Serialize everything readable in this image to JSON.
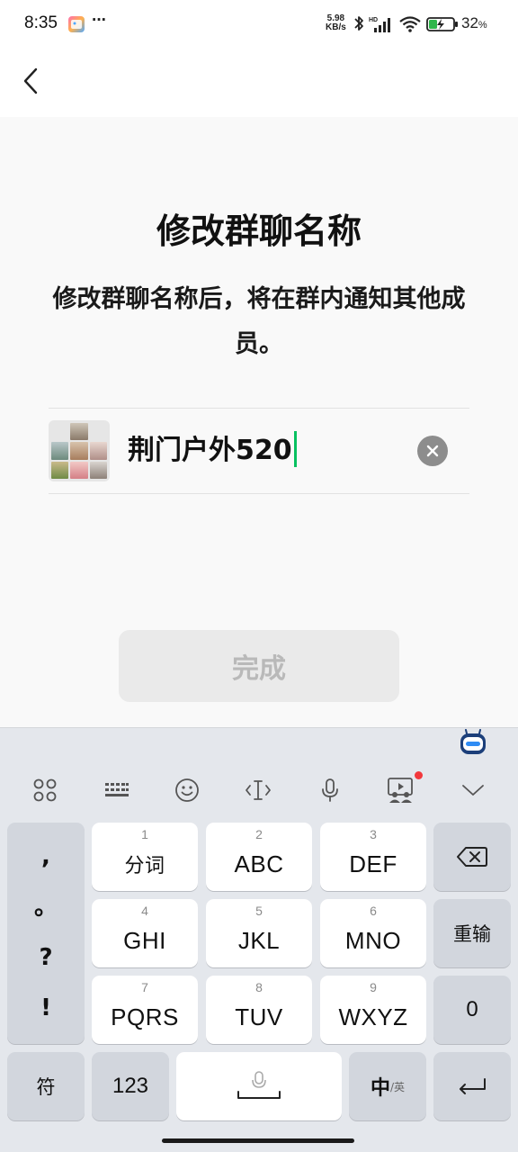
{
  "status_bar": {
    "time": "8:35",
    "dots": "···",
    "net_speed_value": "5.98",
    "net_speed_unit": "KB/s",
    "battery_percent": "32",
    "battery_unit": "%"
  },
  "header": {
    "back_icon": "chevron-left-icon"
  },
  "main": {
    "title": "修改群聊名称",
    "description": "修改群聊名称后，将在群内通知其他成员。",
    "group_name_value": "荆门户外520",
    "clear_icon": "close-circle-icon",
    "done_label": "完成"
  },
  "keyboard": {
    "toolbar_icons": [
      "grid-icon",
      "keyboard-icon",
      "emoji-icon",
      "cursor-icon",
      "microphone-icon",
      "screen-share-icon",
      "chevron-down-icon"
    ],
    "punct": [
      ",",
      "。",
      "?",
      "!"
    ],
    "keys": [
      {
        "num": "1",
        "label": "分词"
      },
      {
        "num": "2",
        "label": "ABC"
      },
      {
        "num": "3",
        "label": "DEF"
      },
      {
        "num": "4",
        "label": "GHI"
      },
      {
        "num": "5",
        "label": "JKL"
      },
      {
        "num": "6",
        "label": "MNO"
      },
      {
        "num": "7",
        "label": "PQRS"
      },
      {
        "num": "8",
        "label": "TUV"
      },
      {
        "num": "9",
        "label": "WXYZ"
      }
    ],
    "reenter_label": "重输",
    "zero_label": "0",
    "symbol_label": "符",
    "numeric_label": "123",
    "lang_main": "中",
    "lang_sub": "/英"
  },
  "colors": {
    "accent_caret": "#07c160",
    "notification_dot": "#f2383c",
    "done_disabled_bg": "#eaeaea"
  }
}
